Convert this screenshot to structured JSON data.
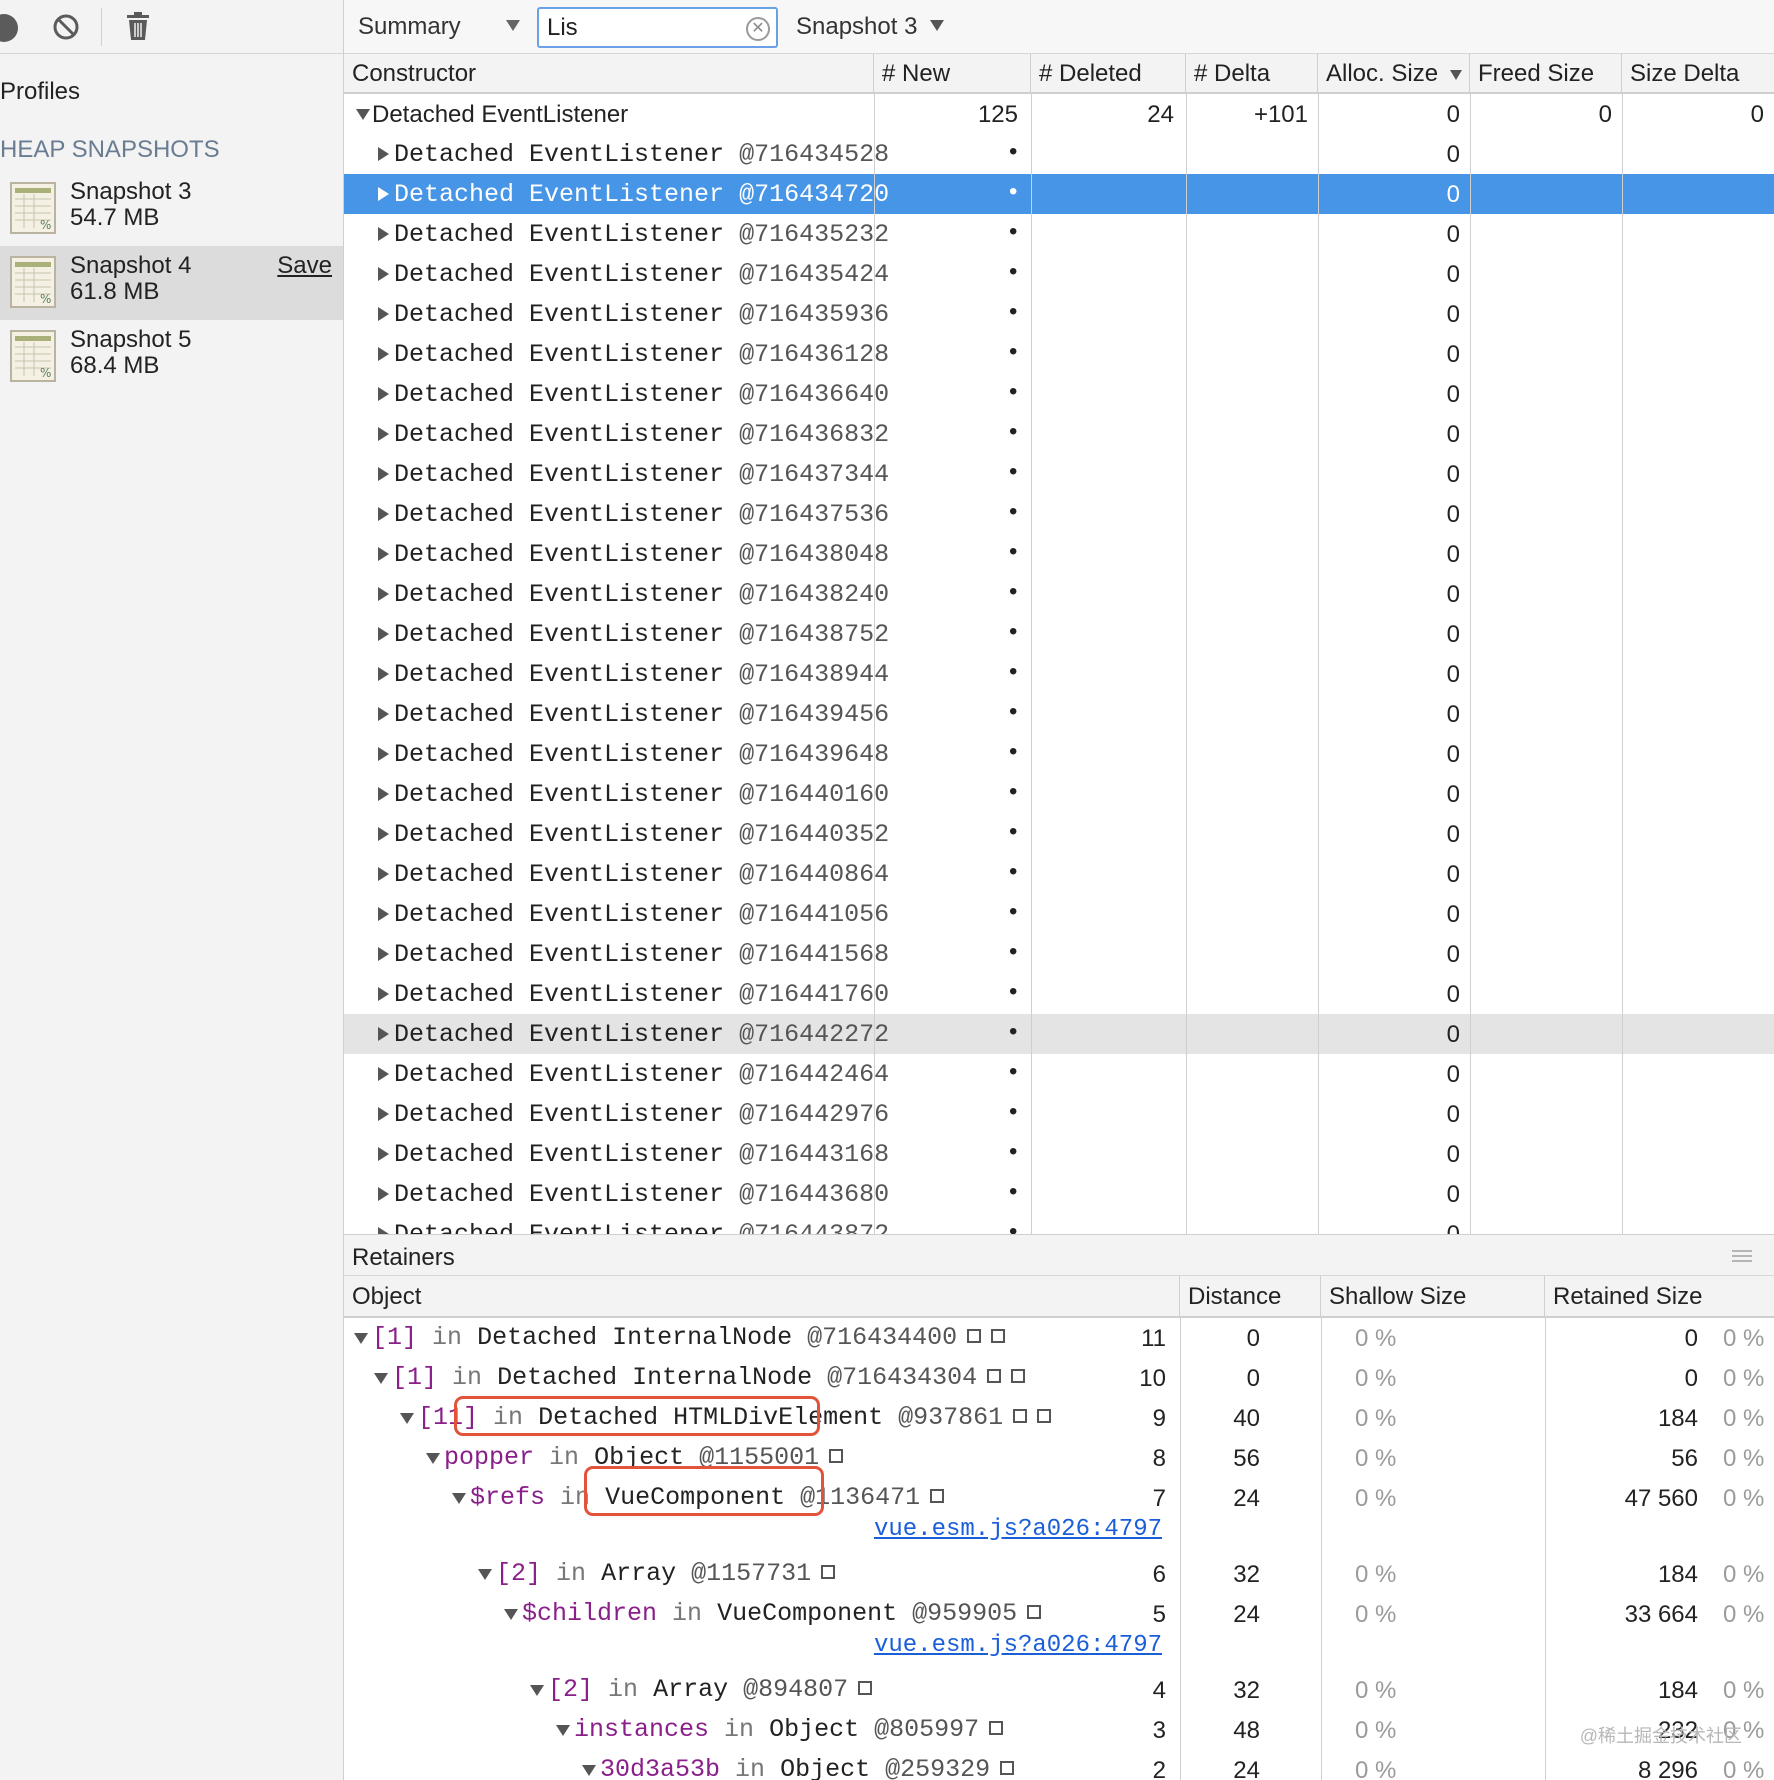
{
  "sidebar": {
    "profiles_label": "Profiles",
    "heap_label": "HEAP SNAPSHOTS",
    "snapshots": [
      {
        "title": "Snapshot 3",
        "size": "54.7 MB"
      },
      {
        "title": "Snapshot 4",
        "size": "61.8 MB",
        "save": "Save",
        "selected": true
      },
      {
        "title": "Snapshot 5",
        "size": "68.4 MB"
      }
    ]
  },
  "toolbar": {
    "view": "Summary",
    "filter_value": "Lis",
    "compare_snapshot": "Snapshot 3"
  },
  "top_table": {
    "headers": [
      "Constructor",
      "# New",
      "# Deleted",
      "# Delta",
      "Alloc. Size",
      "Freed Size",
      "Size Delta"
    ],
    "group": {
      "name": "Detached EventListener",
      "new": "125",
      "deleted": "24",
      "delta": "+101",
      "alloc": "0",
      "freed": "0",
      "size_delta": "0"
    },
    "child_name": "Detached EventListener",
    "child_new": "•",
    "child_alloc": "0",
    "rows": [
      "@716434528",
      "@716434720",
      "@716435232",
      "@716435424",
      "@716435936",
      "@716436128",
      "@716436640",
      "@716436832",
      "@716437344",
      "@716437536",
      "@716438048",
      "@716438240",
      "@716438752",
      "@716438944",
      "@716439456",
      "@716439648",
      "@716440160",
      "@716440352",
      "@716440864",
      "@716441056",
      "@716441568",
      "@716441760",
      "@716442272",
      "@716442464",
      "@716442976",
      "@716443168",
      "@716443680",
      "@716443872"
    ],
    "selected_index": 1,
    "hover_index": 22
  },
  "retainers": {
    "title": "Retainers",
    "headers": [
      "Object",
      "Distance",
      "Shallow Size",
      "Retained Size"
    ],
    "rows": [
      {
        "edge": "[1]",
        "in": "in",
        "obj": "Detached InternalNode",
        "id": "@716434400",
        "distance": "11",
        "shallow": "0",
        "shallow_pct": "0 %",
        "retained": "0",
        "retained_pct": "0 %"
      },
      {
        "edge": "[1]",
        "in": "in",
        "obj": "Detached InternalNode",
        "id": "@716434304",
        "distance": "10",
        "shallow": "0",
        "shallow_pct": "0 %",
        "retained": "0",
        "retained_pct": "0 %"
      },
      {
        "edge": "[11]",
        "in": "in",
        "obj": "Detached HTMLDivElement",
        "id": "@937861",
        "distance": "9",
        "shallow": "40",
        "shallow_pct": "0 %",
        "retained": "184",
        "retained_pct": "0 %"
      },
      {
        "edge": "popper",
        "in": "in",
        "obj": "Object",
        "id": "@1155001",
        "distance": "8",
        "shallow": "56",
        "shallow_pct": "0 %",
        "retained": "56",
        "retained_pct": "0 %"
      },
      {
        "edge": "$refs",
        "in": "in",
        "obj": "VueComponent",
        "id": "@1136471",
        "distance": "7",
        "shallow": "24",
        "shallow_pct": "0 %",
        "retained": "47 560",
        "retained_pct": "0 %",
        "link": "vue.esm.js?a026:4797"
      },
      {
        "edge": "[2]",
        "in": "in",
        "obj": "Array",
        "id": "@1157731",
        "distance": "6",
        "shallow": "32",
        "shallow_pct": "0 %",
        "retained": "184",
        "retained_pct": "0 %"
      },
      {
        "edge": "$children",
        "in": "in",
        "obj": "VueComponent",
        "id": "@959905",
        "distance": "5",
        "shallow": "24",
        "shallow_pct": "0 %",
        "retained": "33 664",
        "retained_pct": "0 %",
        "link": "vue.esm.js?a026:4797"
      },
      {
        "edge": "[2]",
        "in": "in",
        "obj": "Array",
        "id": "@894807",
        "distance": "4",
        "shallow": "32",
        "shallow_pct": "0 %",
        "retained": "184",
        "retained_pct": "0 %"
      },
      {
        "edge": "instances",
        "in": "in",
        "obj": "Object",
        "id": "@805997",
        "distance": "3",
        "shallow": "48",
        "shallow_pct": "0 %",
        "retained": "232",
        "retained_pct": "0 %"
      },
      {
        "edge": "30d3a53b",
        "in": "in",
        "obj": "Object",
        "id": "@259329",
        "distance": "2",
        "shallow": "24",
        "shallow_pct": "0 %",
        "retained": "8 296",
        "retained_pct": "0 %"
      }
    ]
  },
  "watermark": "@稀土掘金技术社区",
  "colors": {
    "selection": "#4795e6",
    "highlight_box": "#e2533a",
    "link": "#1a5ed8",
    "edge_name": "#8a1f8a"
  },
  "icons": [
    "record-icon",
    "clear-icon",
    "trash-icon",
    "snapshot-icon",
    "clear-filter-icon",
    "menu-icon"
  ]
}
